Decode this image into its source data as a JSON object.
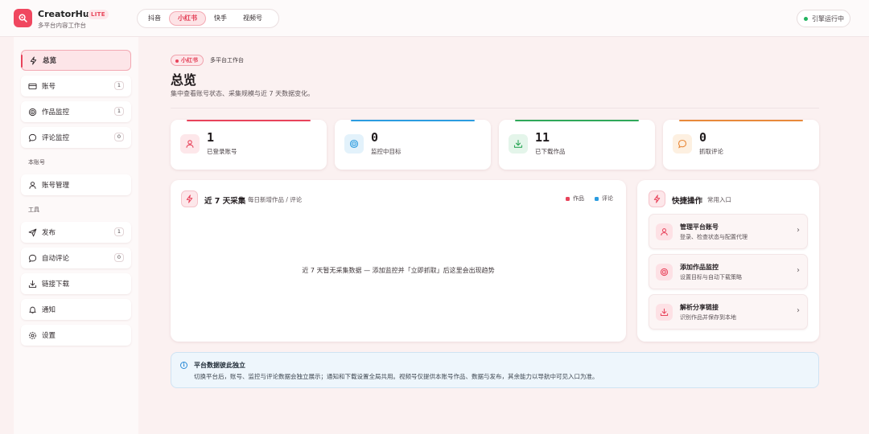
{
  "app": {
    "name": "CreatorHub",
    "badge": "LITE",
    "subtitle": "多平台内容工作台"
  },
  "platform_tabs": [
    {
      "label": "抖音",
      "active": false
    },
    {
      "label": "小红书",
      "active": true
    },
    {
      "label": "快手",
      "active": false
    },
    {
      "label": "视频号",
      "active": false
    }
  ],
  "engine_status": "引擎运行中",
  "sidebar": {
    "items": [
      {
        "label": "总览",
        "icon": "bolt-icon",
        "active": true
      },
      {
        "label": "账号",
        "icon": "card-icon",
        "count": "1"
      },
      {
        "label": "作品监控",
        "icon": "target-icon",
        "count": "1"
      },
      {
        "label": "评论监控",
        "icon": "comment-icon",
        "count": "0"
      }
    ],
    "section_account": "本账号",
    "account_items": [
      {
        "label": "账号管理",
        "icon": "user-icon"
      }
    ],
    "section_tools": "工具",
    "tool_items": [
      {
        "label": "发布",
        "icon": "send-icon",
        "count": "1"
      },
      {
        "label": "自动评论",
        "icon": "comment-icon",
        "count": "0"
      },
      {
        "label": "链接下载",
        "icon": "download-icon"
      },
      {
        "label": "通知",
        "icon": "bell-icon"
      },
      {
        "label": "设置",
        "icon": "gear-icon"
      }
    ]
  },
  "header": {
    "chip": "小红书",
    "chip_label": "多平台工作台",
    "title": "总览",
    "description": "集中查看账号状态、采集规模与近 7 天数据变化。"
  },
  "stats": [
    {
      "value": "1",
      "label": "已登录账号",
      "color": "#e8435b",
      "icon": "user-icon"
    },
    {
      "value": "0",
      "label": "监控中目标",
      "color": "#2b9ce0",
      "icon": "target-icon"
    },
    {
      "value": "11",
      "label": "已下载作品",
      "color": "#2fa85a",
      "icon": "download-icon"
    },
    {
      "value": "0",
      "label": "抓取评论",
      "color": "#e8893a",
      "icon": "comment-icon"
    }
  ],
  "trend": {
    "title": "近 7 天采集",
    "subtitle": "每日新增作品 / 评论",
    "legend": [
      {
        "label": "作品",
        "color": "#e8435b"
      },
      {
        "label": "评论",
        "color": "#2b9ce0"
      }
    ],
    "empty_message": "近 7 天暂无采集数据 — 添加监控并「立即抓取」后这里会出现趋势"
  },
  "quick": {
    "title": "快捷操作",
    "subtitle": "常用入口",
    "actions": [
      {
        "title": "管理平台账号",
        "desc": "登录、检查状态与配置代理",
        "icon": "user-icon"
      },
      {
        "title": "添加作品监控",
        "desc": "设置目标与自动下载策略",
        "icon": "target-icon"
      },
      {
        "title": "解析分享链接",
        "desc": "识别作品并保存到本地",
        "icon": "download-icon"
      }
    ]
  },
  "notice": {
    "title": "平台数据彼此独立",
    "text": "切换平台后，账号、监控与评论数据会独立展示；通知和下载设置全局共用。视频号仅提供本账号作品、数据与发布，其余能力以导航中可见入口为准。"
  }
}
